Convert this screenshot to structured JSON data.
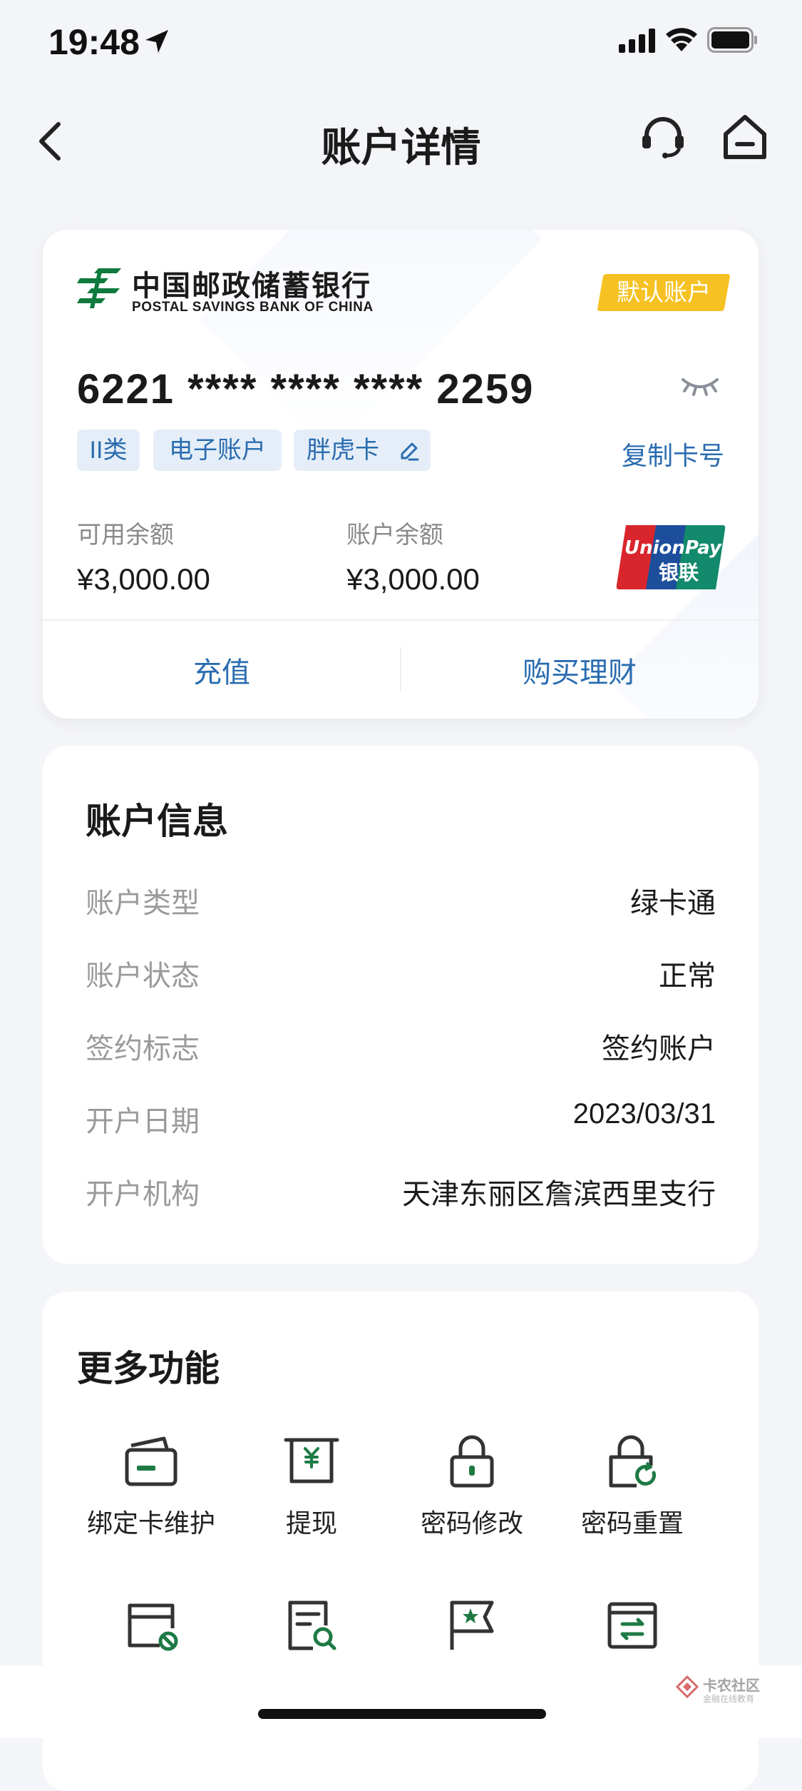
{
  "status_bar": {
    "time": "19:48"
  },
  "nav": {
    "title": "账户详情"
  },
  "card": {
    "bank_name_cn": "中国邮政储蓄银行",
    "bank_name_en": "POSTAL SAVINGS BANK OF CHINA",
    "default_badge": "默认账户",
    "card_number": "6221 **** **** **** 2259",
    "tags": [
      "II类",
      "电子账户",
      "胖虎卡"
    ],
    "copy_label": "复制卡号",
    "available_balance_label": "可用余额",
    "available_balance": "¥3,000.00",
    "account_balance_label": "账户余额",
    "account_balance": "¥3,000.00",
    "actions": {
      "recharge": "充值",
      "buy_wealth": "购买理财"
    }
  },
  "account_info": {
    "title": "账户信息",
    "rows": [
      {
        "key": "账户类型",
        "value": "绿卡通"
      },
      {
        "key": "账户状态",
        "value": "正常"
      },
      {
        "key": "签约标志",
        "value": "签约账户"
      },
      {
        "key": "开户日期",
        "value": "2023/03/31"
      },
      {
        "key": "开户机构",
        "value": "天津东丽区詹滨西里支行"
      }
    ]
  },
  "more_functions": {
    "title": "更多功能",
    "items": [
      {
        "label": "绑定卡维护",
        "icon": "bind-card-icon"
      },
      {
        "label": "提现",
        "icon": "withdraw-icon"
      },
      {
        "label": "密码修改",
        "icon": "lock-icon"
      },
      {
        "label": "密码重置",
        "icon": "lock-reset-icon"
      },
      {
        "label": "",
        "icon": "card-cancel-icon"
      },
      {
        "label": "",
        "icon": "document-search-icon"
      },
      {
        "label": "",
        "icon": "flag-star-icon"
      },
      {
        "label": "",
        "icon": "card-transfer-icon"
      }
    ]
  },
  "watermark": {
    "title": "卡农社区",
    "subtitle": "金融在线教育"
  },
  "colors": {
    "accent_blue": "#2a6cb0",
    "badge_yellow": "#f6c223",
    "psbc_green": "#0f7a3d",
    "icon_green": "#1e7a45"
  }
}
